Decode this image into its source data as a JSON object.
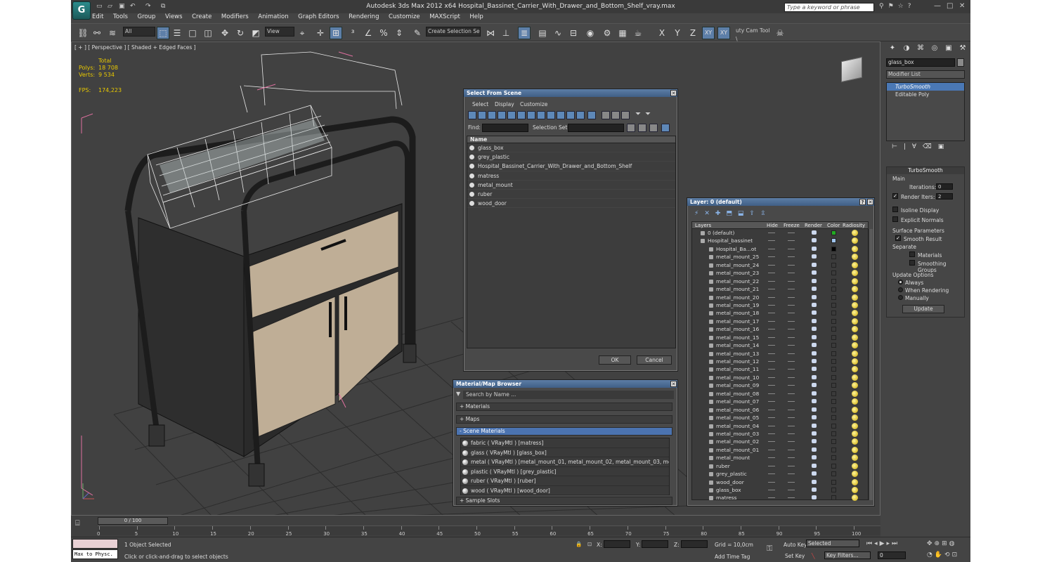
{
  "app": {
    "title": "Autodesk 3ds Max  2012 x64    Hospital_Bassinet_Carrier_With_Drawer_and_Bottom_Shelf_vray.max",
    "search_placeholder": "Type a keyword or phrase",
    "menu": [
      "Edit",
      "Tools",
      "Group",
      "Views",
      "Create",
      "Modifiers",
      "Animation",
      "Graph Editors",
      "Rendering",
      "Customize",
      "MAXScript",
      "Help"
    ]
  },
  "toolbar": {
    "filter": "All",
    "ref_coord": "View",
    "selection_set": "Create Selection Se",
    "axis_x": "X",
    "axis_y": "Y",
    "axis_z": "Z",
    "axis_xy": "XY",
    "axis_xy2": "XY",
    "tool_label": "uty Cam Tool \\"
  },
  "viewport": {
    "label": "[ + ] [ Perspective ] [ Shaded + Edged Faces ]",
    "stats": {
      "total_label": "Total",
      "polys_label": "Polys:",
      "polys": "18 708",
      "verts_label": "Verts:",
      "verts": "9 534",
      "fps_label": "FPS:",
      "fps": "174,223"
    }
  },
  "command_panel": {
    "object_name": "glass_box",
    "modifier_list": "Modifier List",
    "stack": [
      "TurboSmooth",
      "Editable Poly"
    ],
    "turbosmooth": {
      "title": "TurboSmooth",
      "main": "Main",
      "iterations_label": "Iterations:",
      "iterations": "0",
      "render_iters_label": "Render Iters:",
      "render_iters": "2",
      "isoline": "Isoline Display",
      "explicit_normals": "Explicit Normals",
      "surface_params": "Surface Parameters",
      "smooth_result": "Smooth Result",
      "separate": "Separate",
      "materials": "Materials",
      "smoothing_groups": "Smoothing Groups",
      "update_options": "Update Options",
      "always": "Always",
      "when_rendering": "When Rendering",
      "manually": "Manually",
      "update_button": "Update"
    }
  },
  "select_from_scene": {
    "title": "Select From Scene",
    "menu": [
      "Select",
      "Display",
      "Customize"
    ],
    "find_label": "Find:",
    "selection_set_label": "Selection Set:",
    "column_name": "Name",
    "items": [
      "glass_box",
      "grey_plastic",
      "Hospital_Bassinet_Carrier_With_Drawer_and_Bottom_Shelf",
      "matress",
      "metal_mount",
      "ruber",
      "wood_door"
    ],
    "ok": "OK",
    "cancel": "Cancel"
  },
  "material_browser": {
    "title": "Material/Map Browser",
    "search": "Search by Name ...",
    "sections": [
      "+ Materials",
      "+ Maps",
      "- Scene Materials",
      "+ Sample Slots"
    ],
    "materials": [
      "fabric  ( VRayMtl )  [matress]",
      "glass  ( VRayMtl )  [glass_box]",
      "metal  ( VRayMtl )  [metal_mount_01, metal_mount_02, metal_mount_03, metal...",
      "plastic  ( VRayMtl )  [grey_plastic]",
      "ruber  ( VRayMtl )  [ruber]",
      "wood  ( VRayMtl )  [wood_door]"
    ]
  },
  "layer_dialog": {
    "title": "Layer: 0 (default)",
    "columns": [
      "Layers",
      "Hide",
      "Freeze",
      "Render",
      "Color",
      "Radiosity"
    ],
    "rows": [
      {
        "name": "0 (default)",
        "level": 0,
        "color": "#22aa22"
      },
      {
        "name": "Hospital_bassinet",
        "level": 0,
        "color": "#9fc4ee"
      },
      {
        "name": "Hospital_Ba...ot",
        "level": 1,
        "color": "#000000"
      },
      {
        "name": "metal_mount_25",
        "level": 1,
        "color": ""
      },
      {
        "name": "metal_mount_24",
        "level": 1,
        "color": ""
      },
      {
        "name": "metal_mount_23",
        "level": 1,
        "color": ""
      },
      {
        "name": "metal_mount_22",
        "level": 1,
        "color": ""
      },
      {
        "name": "metal_mount_21",
        "level": 1,
        "color": ""
      },
      {
        "name": "metal_mount_20",
        "level": 1,
        "color": ""
      },
      {
        "name": "metal_mount_19",
        "level": 1,
        "color": ""
      },
      {
        "name": "metal_mount_18",
        "level": 1,
        "color": ""
      },
      {
        "name": "metal_mount_17",
        "level": 1,
        "color": ""
      },
      {
        "name": "metal_mount_16",
        "level": 1,
        "color": ""
      },
      {
        "name": "metal_mount_15",
        "level": 1,
        "color": ""
      },
      {
        "name": "metal_mount_14",
        "level": 1,
        "color": ""
      },
      {
        "name": "metal_mount_13",
        "level": 1,
        "color": ""
      },
      {
        "name": "metal_mount_12",
        "level": 1,
        "color": ""
      },
      {
        "name": "metal_mount_11",
        "level": 1,
        "color": ""
      },
      {
        "name": "metal_mount_10",
        "level": 1,
        "color": ""
      },
      {
        "name": "metal_mount_09",
        "level": 1,
        "color": ""
      },
      {
        "name": "metal_mount_08",
        "level": 1,
        "color": ""
      },
      {
        "name": "metal_mount_07",
        "level": 1,
        "color": ""
      },
      {
        "name": "metal_mount_06",
        "level": 1,
        "color": ""
      },
      {
        "name": "metal_mount_05",
        "level": 1,
        "color": ""
      },
      {
        "name": "metal_mount_04",
        "level": 1,
        "color": ""
      },
      {
        "name": "metal_mount_03",
        "level": 1,
        "color": ""
      },
      {
        "name": "metal_mount_02",
        "level": 1,
        "color": ""
      },
      {
        "name": "metal_mount_01",
        "level": 1,
        "color": ""
      },
      {
        "name": "metal_mount",
        "level": 1,
        "color": ""
      },
      {
        "name": "ruber",
        "level": 1,
        "color": ""
      },
      {
        "name": "grey_plastic",
        "level": 1,
        "color": ""
      },
      {
        "name": "wood_door",
        "level": 1,
        "color": ""
      },
      {
        "name": "glass_box",
        "level": 1,
        "color": ""
      },
      {
        "name": "matress",
        "level": 1,
        "color": ""
      }
    ]
  },
  "timeline": {
    "slider": "0 / 100",
    "ticks": [
      "0",
      "5",
      "10",
      "15",
      "20",
      "25",
      "30",
      "35",
      "40",
      "45",
      "50",
      "55",
      "60",
      "65",
      "70",
      "75",
      "80",
      "85",
      "90",
      "95",
      "100"
    ]
  },
  "status": {
    "maxscript": "Max to Physc.",
    "selected": "1 Object Selected",
    "prompt": "Click or click-and-drag to select objects",
    "x_label": "X:",
    "y_label": "Y:",
    "z_label": "Z:",
    "grid": "Grid = 10,0cm",
    "add_time_tag": "Add Time Tag",
    "auto_key": "Auto Key",
    "selected_dropdown": "Selected",
    "set_key": "Set Key",
    "key_filters": "Key Filters...",
    "frame": "0"
  }
}
